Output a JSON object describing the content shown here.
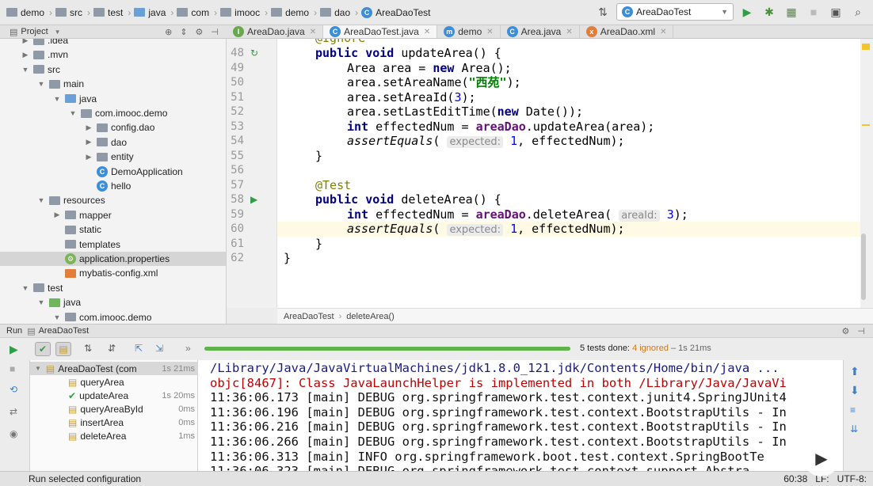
{
  "breadcrumb": [
    {
      "label": "demo",
      "icon": "folder-icon"
    },
    {
      "label": "src",
      "icon": "folder-icon"
    },
    {
      "label": "test",
      "icon": "folder-icon"
    },
    {
      "label": "java",
      "icon": "folder-icon"
    },
    {
      "label": "com",
      "icon": "folder-icon"
    },
    {
      "label": "imooc",
      "icon": "folder-icon"
    },
    {
      "label": "demo",
      "icon": "folder-icon"
    },
    {
      "label": "dao",
      "icon": "folder-icon"
    },
    {
      "label": "AreaDaoTest",
      "icon": "class-icon"
    }
  ],
  "toolbar": {
    "run_config": "AreaDaoTest"
  },
  "project": {
    "header": "Project"
  },
  "tree": [
    {
      "label": ".idea",
      "arrow": "▶",
      "kind": "folder"
    },
    {
      "label": ".mvn",
      "arrow": "▶",
      "kind": "folder"
    },
    {
      "label": "src",
      "arrow": "▼",
      "kind": "folder"
    },
    {
      "label": "main",
      "arrow": "▼",
      "kind": "folder"
    },
    {
      "label": "java",
      "arrow": "▼",
      "kind": "folder-blue"
    },
    {
      "label": "com.imooc.demo",
      "arrow": "▼",
      "kind": "folder"
    },
    {
      "label": "config.dao",
      "arrow": "▶",
      "kind": "folder"
    },
    {
      "label": "dao",
      "arrow": "▶",
      "kind": "folder"
    },
    {
      "label": "entity",
      "arrow": "▶",
      "kind": "folder"
    },
    {
      "label": "DemoApplication",
      "arrow": "",
      "kind": "class"
    },
    {
      "label": "hello",
      "arrow": "",
      "kind": "class"
    },
    {
      "label": "resources",
      "arrow": "▼",
      "kind": "folder"
    },
    {
      "label": "mapper",
      "arrow": "▶",
      "kind": "folder"
    },
    {
      "label": "static",
      "arrow": "",
      "kind": "folder"
    },
    {
      "label": "templates",
      "arrow": "",
      "kind": "folder"
    },
    {
      "label": "application.properties",
      "arrow": "",
      "kind": "props"
    },
    {
      "label": "mybatis-config.xml",
      "arrow": "",
      "kind": "xml"
    },
    {
      "label": "test",
      "arrow": "▼",
      "kind": "folder"
    },
    {
      "label": "java",
      "arrow": "▼",
      "kind": "folder-green"
    },
    {
      "label": "com.imooc.demo",
      "arrow": "▼",
      "kind": "folder"
    }
  ],
  "tabs": [
    {
      "label": "AreaDao.java",
      "icon": "interface-icon"
    },
    {
      "label": "AreaDaoTest.java",
      "icon": "class-icon",
      "active": true
    },
    {
      "label": "demo",
      "icon": "module-icon"
    },
    {
      "label": "Area.java",
      "icon": "class-icon"
    },
    {
      "label": "AreaDao.xml",
      "icon": "xml-icon"
    }
  ],
  "code": {
    "line_numbers": [
      "48",
      "49",
      "50",
      "51",
      "52",
      "53",
      "54",
      "55",
      "56",
      "57",
      "58",
      "59",
      "60",
      "61",
      "62"
    ],
    "top_partial": "@Ignore",
    "str_xiyuan": "\"西苑\"",
    "hint_expected": "expected:",
    "hint_areaid": "areaId:"
  },
  "editor_breadcrumb": {
    "class": "AreaDaoTest",
    "method": "deleteArea()"
  },
  "run": {
    "header_label": "Run",
    "header_config": "AreaDaoTest",
    "summary": "5 tests done:",
    "ignored": "4 ignored",
    "time": "– 1s 21ms",
    "progress": 1.0
  },
  "tests": [
    {
      "label": "AreaDaoTest (com",
      "duration": "1s 21ms",
      "status": "ignored"
    },
    {
      "label": "queryArea",
      "duration": "",
      "status": "ignored"
    },
    {
      "label": "updateArea",
      "duration": "1s 20ms",
      "status": "passed"
    },
    {
      "label": "queryAreaById",
      "duration": "0ms",
      "status": "ignored"
    },
    {
      "label": "insertArea",
      "duration": "0ms",
      "status": "ignored"
    },
    {
      "label": "deleteArea",
      "duration": "1ms",
      "status": "ignored"
    }
  ],
  "console": [
    {
      "text": "/Library/Java/JavaVirtualMachines/jdk1.8.0_121.jdk/Contents/Home/bin/java ...",
      "color": "#1a1a80"
    },
    {
      "text": "objc[8467]: Class JavaLaunchHelper is implemented in both /Library/Java/JavaVi",
      "color": "#c00000"
    },
    {
      "text": "11:36:06.173 [main] DEBUG org.springframework.test.context.junit4.SpringJUnit4",
      "color": "#111"
    },
    {
      "text": "11:36:06.196 [main] DEBUG org.springframework.test.context.BootstrapUtils - In",
      "color": "#111"
    },
    {
      "text": "11:36:06.216 [main] DEBUG org.springframework.test.context.BootstrapUtils - In",
      "color": "#111"
    },
    {
      "text": "11:36:06.266 [main] DEBUG org.springframework.test.context.BootstrapUtils - In",
      "color": "#111"
    },
    {
      "text": "11:36:06.313 [main] INFO org.springframework.boot.test.context.SpringBootTe",
      "color": "#111"
    },
    {
      "text": "11:36:06.323 [main] DEBUG org.springframework.test.context.support.Abstra",
      "color": "#111"
    }
  ],
  "status": {
    "text": "Run selected configuration",
    "position": "60:38",
    "lf": "LF:",
    "encoding": "UTF-8:"
  }
}
